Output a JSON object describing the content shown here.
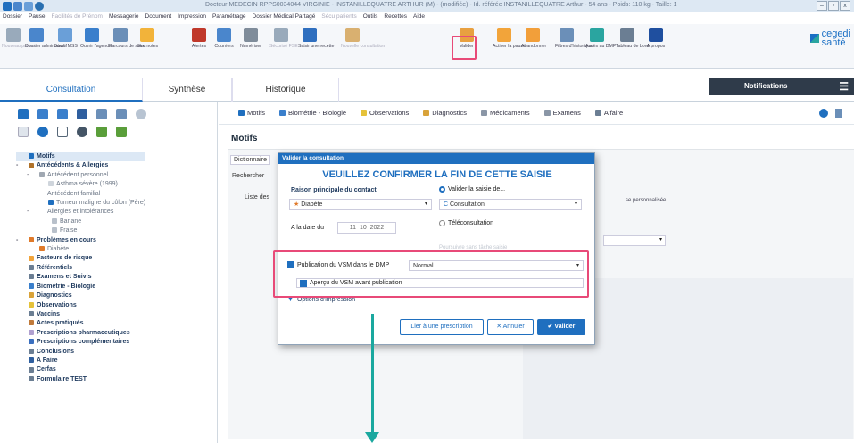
{
  "titlebar": {
    "title": "Docteur MEDECIN RPPS0034044 VIRGINIE - INSTANILLEQUATRE ARTHUR (M) - (modifiée) - Id. référée INSTANILLEQUATRE Arthur - 54 ans - Poids: 110 kg - Taille: 1",
    "min": "–",
    "max": "▫",
    "close": "x"
  },
  "menu": [
    "Dossier",
    "Pause",
    "Facilités de Prénom",
    "Messagerie",
    "Document",
    "Impression",
    "Paramétrage",
    "Dossier Médical Partagé",
    "Sécu patients",
    "Outils",
    "Recettes",
    "Aide"
  ],
  "ribbon": [
    {
      "label": "Nouveau patient",
      "dim": true
    },
    {
      "label": "Dossier administratif"
    },
    {
      "label": "Ouvrir MSS"
    },
    {
      "label": "Ouvrir l'agenda"
    },
    {
      "label": "Parcours de soins"
    },
    {
      "label": "Bloc notes"
    },
    {
      "label": "Alertes"
    },
    {
      "label": "Courriers"
    },
    {
      "label": "Numériser"
    },
    {
      "label": "Sécurisé FSE",
      "dim": true
    },
    {
      "label": "Saisir une recette"
    },
    {
      "label": "Nouvelle consultation",
      "dim": true
    },
    {
      "label": "Valider"
    },
    {
      "label": "Activer la pause"
    },
    {
      "label": "Abandonner"
    },
    {
      "label": "Filtres d'historique"
    },
    {
      "label": "Accès au DMP"
    },
    {
      "label": "Tableau de bord"
    },
    {
      "label": "A propos"
    }
  ],
  "brand": {
    "line1": "cegedi",
    "line2": "santé"
  },
  "tabs": {
    "consultation": "Consultation",
    "synthese": "Synthèse",
    "historique": "Historique",
    "notifications": "Notifications",
    "menu_icon": "☰"
  },
  "tree": [
    {
      "t": "Motifs",
      "cls": "b sel",
      "ind": 0,
      "c": "#1f6fbf"
    },
    {
      "t": "Antécédents & Allergies",
      "cls": "b",
      "ind": 0,
      "c": "#b0722a",
      "exp": "-"
    },
    {
      "t": "Antécédent personnel",
      "cls": "g",
      "ind": 12,
      "c": "#a0a8b2",
      "exp": "-"
    },
    {
      "t": "Asthma sévère (1999)",
      "cls": "g",
      "ind": 22,
      "c": "#cfd5dc"
    },
    {
      "t": "Antécédent familial",
      "cls": "g",
      "ind": 12,
      "c": ""
    },
    {
      "t": "Tumeur maligne du côlon (Père)",
      "cls": "g",
      "ind": 22,
      "c": "#1f6fbf"
    },
    {
      "t": "Allergies et intolérances",
      "cls": "g",
      "ind": 12,
      "c": "",
      "exp": "-"
    },
    {
      "t": "Banane",
      "cls": "g",
      "ind": 26,
      "c": "#b8c0ca"
    },
    {
      "t": "Fraise",
      "cls": "g",
      "ind": 26,
      "c": "#b8c0ca"
    },
    {
      "t": "Problèmes en cours",
      "cls": "b",
      "ind": 0,
      "c": "#e07a2a",
      "exp": "-"
    },
    {
      "t": "Diabète",
      "cls": "g",
      "ind": 12,
      "c": "#e07a2a"
    },
    {
      "t": "Facteurs de risque",
      "cls": "b",
      "ind": 0,
      "c": "#f2a43a"
    },
    {
      "t": "Référentiels",
      "cls": "b",
      "ind": 0,
      "c": "#6b7e93"
    },
    {
      "t": "Examens et Suivis",
      "cls": "b",
      "ind": 0,
      "c": "#6b7e93"
    },
    {
      "t": "Biométrie - Biologie",
      "cls": "b",
      "ind": 0,
      "c": "#3a7fcc"
    },
    {
      "t": "Diagnostics",
      "cls": "b",
      "ind": 0,
      "c": "#d9a33a"
    },
    {
      "t": "Observations",
      "cls": "b",
      "ind": 0,
      "c": "#e5c23a"
    },
    {
      "t": "Vaccins",
      "cls": "b",
      "ind": 0,
      "c": "#6b7e93"
    },
    {
      "t": "Actes pratiqués",
      "cls": "b",
      "ind": 0,
      "c": "#c07a3a"
    },
    {
      "t": "Prescriptions pharmaceutiques",
      "cls": "b",
      "ind": 0,
      "c": "#b0a0d0"
    },
    {
      "t": "Prescriptions complémentaires",
      "cls": "b",
      "ind": 0,
      "c": "#3a6fbf"
    },
    {
      "t": "Conclusions",
      "cls": "b",
      "ind": 0,
      "c": "#6b7e93"
    },
    {
      "t": "A Faire",
      "cls": "b",
      "ind": 0,
      "c": "#2f5f9f"
    },
    {
      "t": "Cerfas",
      "cls": "b",
      "ind": 0,
      "c": "#6b7e93"
    },
    {
      "t": "Formulaire TEST",
      "cls": "b",
      "ind": 0,
      "c": "#6b7e93"
    }
  ],
  "subtabs": [
    {
      "t": "Motifs",
      "c": "#1f6fbf"
    },
    {
      "t": "Biométrie - Biologie",
      "c": "#3a7fcc"
    },
    {
      "t": "Observations",
      "c": "#e5c23a"
    },
    {
      "t": "Diagnostics",
      "c": "#d9a33a"
    },
    {
      "t": "Médicaments",
      "c": "#8a96a6"
    },
    {
      "t": "Examens",
      "c": "#8a96a6"
    },
    {
      "t": "A faire",
      "c": "#6b7e93"
    }
  ],
  "motifs": {
    "title": "Motifs",
    "dictionnaire": "Dictionnaire",
    "rechercher": "Rechercher",
    "liste": "Liste des",
    "perso": "se personnalisée"
  },
  "modal": {
    "header": "Valider la consultation",
    "title": "VEUILLEZ CONFIRMER LA FIN DE CETTE SAISIE",
    "raison": "Raison principale du contact",
    "raison_value": "Diabète",
    "valider_saisie": "Valider la saisie de...",
    "saisie_value": "Consultation",
    "date_label": "A la date du",
    "date_d": "11",
    "date_m": "10",
    "date_y": "2022",
    "tele": "Téléconsultation",
    "hidden_opt": "Poursuivre sans tâche saisie",
    "pub": "Publication du VSM dans le DMP",
    "pub_value": "Normal",
    "apercu": "Aperçu du VSM avant publication",
    "options": "Options d'impression",
    "btn_lier": "Lier à une prescription",
    "btn_annuler": "Annuler",
    "btn_valider": "Valider"
  }
}
